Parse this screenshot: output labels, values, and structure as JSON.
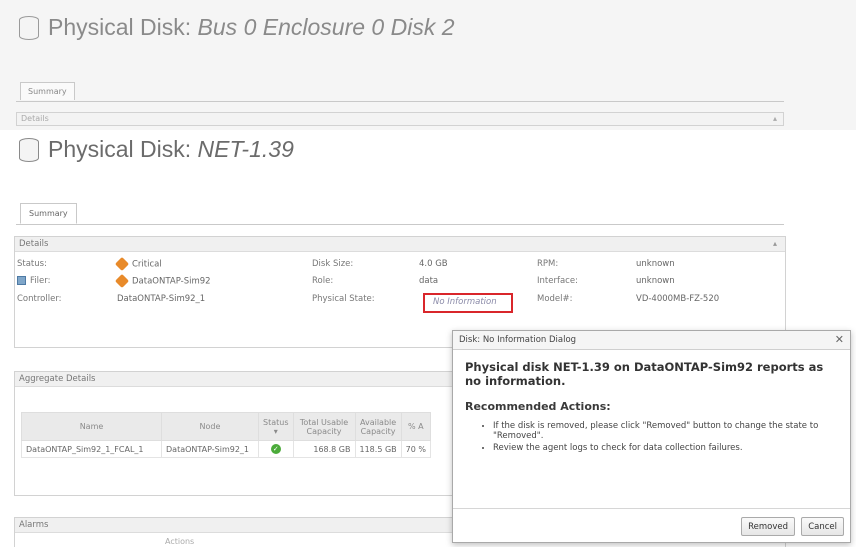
{
  "background_page": {
    "title_prefix": "Physical Disk:",
    "title_name": "Bus 0 Enclosure 0 Disk 2",
    "tab": "Summary",
    "details_label": "Details"
  },
  "page": {
    "title_prefix": "Physical Disk:",
    "title_name": "NET-1.39",
    "tab": "Summary"
  },
  "details": {
    "header": "Details",
    "status_label": "Status:",
    "status_value": "Critical",
    "filer_label": "Filer:",
    "filer_value": "DataONTAP-Sim92",
    "controller_label": "Controller:",
    "controller_value": "DataONTAP-Sim92_1",
    "disk_size_label": "Disk Size:",
    "disk_size_value": "4.0 GB",
    "role_label": "Role:",
    "role_value": "data",
    "physical_state_label": "Physical State:",
    "physical_state_value": "No Information",
    "rpm_label": "RPM:",
    "rpm_value": "unknown",
    "interface_label": "Interface:",
    "interface_value": "unknown",
    "model_label": "Model#:",
    "model_value": "VD-4000MB-FZ-520"
  },
  "aggregate": {
    "header": "Aggregate Details",
    "columns": [
      "Name",
      "Node",
      "Status",
      "Total Usable Capacity",
      "Available Capacity",
      "% A"
    ],
    "rows": [
      {
        "name": "DataONTAP_Sim92_1_FCAL_1",
        "node": "DataONTAP-Sim92_1",
        "total": "168.8 GB",
        "available": "118.5 GB",
        "pct": "70 %"
      }
    ]
  },
  "alarms": {
    "header": "Alarms",
    "sub": "Actions"
  },
  "dialog": {
    "title": "Disk: No Information Dialog",
    "message": "Physical disk NET-1.39 on DataONTAP-Sim92 reports as no information.",
    "recommended_heading": "Recommended Actions:",
    "actions": [
      "If the disk is removed, please click \"Removed\" button to change the state to \"Removed\".",
      "Review the agent logs to check for data collection failures."
    ],
    "removed_label": "Removed",
    "cancel_label": "Cancel"
  },
  "colors": {
    "highlight": "#d9262b",
    "critical": "#e88a2a",
    "ok": "#4bab3a"
  }
}
